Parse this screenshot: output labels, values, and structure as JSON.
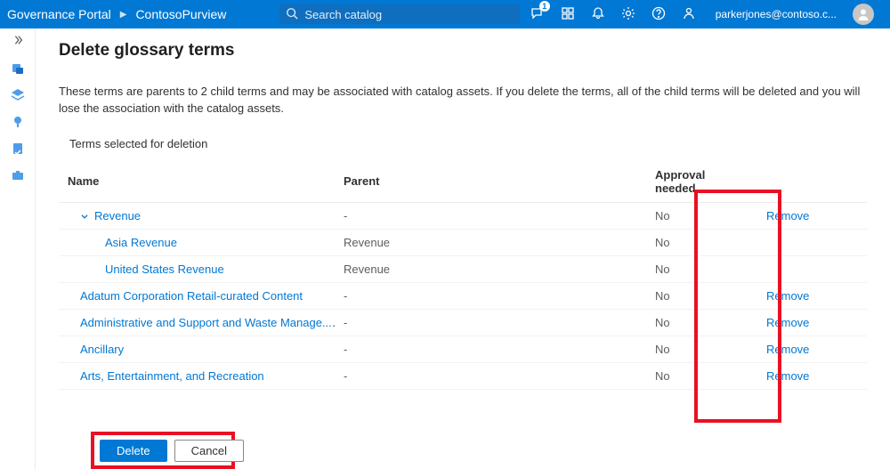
{
  "header": {
    "portal": "Governance Portal",
    "workspace": "ContosoPurview",
    "search_placeholder": "Search catalog",
    "notification_badge": "1",
    "user_email": "parkerjones@contoso.c..."
  },
  "page": {
    "title": "Delete glossary terms",
    "intro": "These terms are parents to 2 child terms and may be associated with catalog assets. If you delete the terms, all of the child terms will be deleted and you will lose the association with the catalog assets.",
    "subhead": "Terms selected for deletion"
  },
  "table": {
    "headers": {
      "name": "Name",
      "parent": "Parent",
      "approval": "Approval needed"
    },
    "remove_label": "Remove",
    "rows": [
      {
        "name": "Revenue",
        "parent": "-",
        "approval": "No",
        "indent": 1,
        "expandable": true,
        "remove": true
      },
      {
        "name": "Asia Revenue",
        "parent": "Revenue",
        "approval": "No",
        "indent": 2,
        "remove": false
      },
      {
        "name": "United States Revenue",
        "parent": "Revenue",
        "approval": "No",
        "indent": 2,
        "remove": false
      },
      {
        "name": "Adatum Corporation Retail-curated Content",
        "parent": "-",
        "approval": "No",
        "indent": 1,
        "remove": true
      },
      {
        "name": "Administrative and Support and Waste Manage...",
        "parent": "-",
        "approval": "No",
        "indent": 1,
        "remove": true
      },
      {
        "name": "Ancillary",
        "parent": "-",
        "approval": "No",
        "indent": 1,
        "remove": true
      },
      {
        "name": "Arts, Entertainment, and Recreation",
        "parent": "-",
        "approval": "No",
        "indent": 1,
        "remove": true
      }
    ]
  },
  "footer": {
    "delete": "Delete",
    "cancel": "Cancel"
  }
}
